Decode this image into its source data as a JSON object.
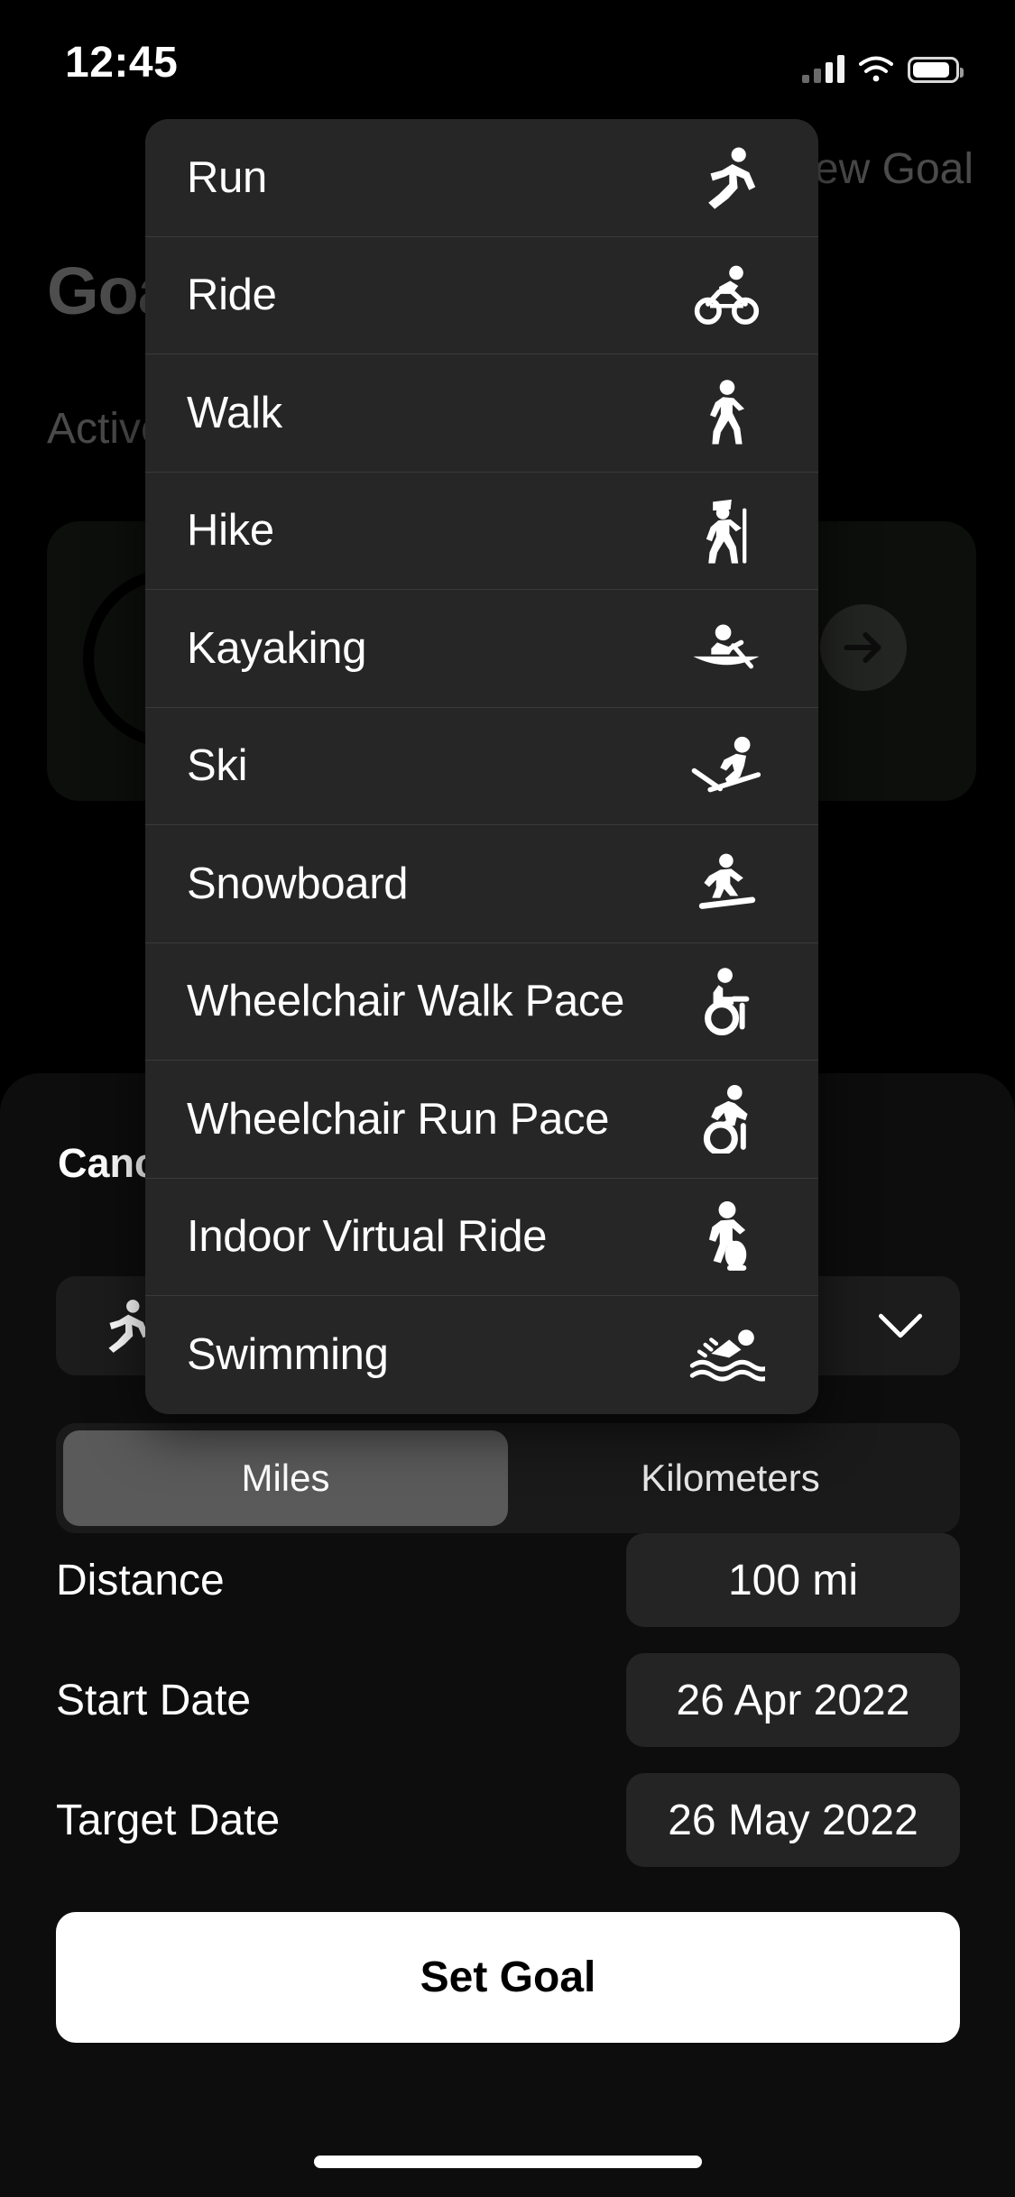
{
  "status_bar": {
    "time": "12:45",
    "signal_icon": "cellular-bars-icon",
    "wifi_icon": "wifi-icon",
    "battery_icon": "battery-icon"
  },
  "background": {
    "nav_title": "New Goal",
    "page_title": "Goals",
    "section_label": "Active",
    "arrow_icon": "arrow-right-icon",
    "ring_icon": "progress-ring-icon"
  },
  "sheet": {
    "cancel_label": "Cancel",
    "activity_selector": {
      "icon": "run-icon",
      "chevron_icon": "chevron-down-icon"
    },
    "units": {
      "options": [
        "Miles",
        "Kilometers"
      ],
      "selected": "Miles"
    },
    "fields": [
      {
        "label": "Distance",
        "value": "100 mi"
      },
      {
        "label": "Start Date",
        "value": "26 Apr 2022"
      },
      {
        "label": "Target Date",
        "value": "26 May 2022"
      }
    ],
    "submit_label": "Set Goal"
  },
  "dropdown": {
    "items": [
      {
        "label": "Run",
        "icon": "run-icon"
      },
      {
        "label": "Ride",
        "icon": "bike-icon"
      },
      {
        "label": "Walk",
        "icon": "walk-icon"
      },
      {
        "label": "Hike",
        "icon": "hike-icon"
      },
      {
        "label": "Kayaking",
        "icon": "kayak-icon"
      },
      {
        "label": "Ski",
        "icon": "ski-icon"
      },
      {
        "label": "Snowboard",
        "icon": "snowboard-icon"
      },
      {
        "label": "Wheelchair Walk Pace",
        "icon": "wheelchair-walk-icon"
      },
      {
        "label": "Wheelchair Run Pace",
        "icon": "wheelchair-run-icon"
      },
      {
        "label": "Indoor Virtual Ride",
        "icon": "indoor-ride-icon"
      },
      {
        "label": "Swimming",
        "icon": "swim-icon"
      }
    ]
  },
  "colors": {
    "background": "#000000",
    "sheet": "#0d0d0d",
    "dropdown": "#262626",
    "divider": "#3a3a3a",
    "field": "#242424",
    "segment_selected": "#5a5a5a",
    "accent_button": "#ffffff",
    "dim_text": "#4b4b4b"
  },
  "home_indicator": "home-indicator"
}
